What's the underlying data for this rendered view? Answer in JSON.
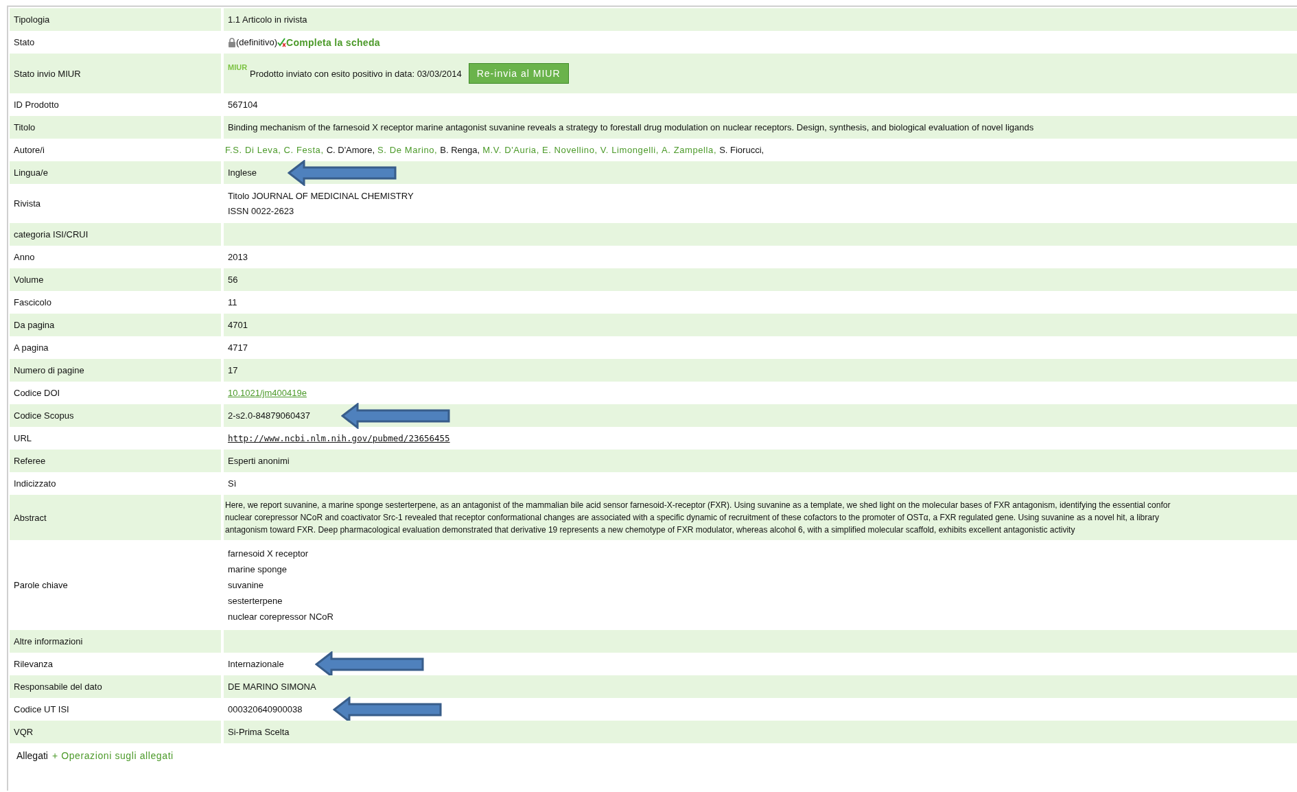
{
  "record": {
    "rows": [
      {
        "label": "Tipologia",
        "kind": "text",
        "value": "1.1 Articolo in rivista",
        "arrow": false
      },
      {
        "label": "Stato",
        "kind": "status",
        "locked": true,
        "value": "(definitivo)",
        "link": "Completa la scheda",
        "arrow": false
      },
      {
        "label": "Stato invio MIUR",
        "kind": "miur",
        "logo": "MIUR",
        "value": "Prodotto inviato con esito positivo in data: 03/03/2014",
        "button": "Re-invia al MIUR",
        "arrow": false
      },
      {
        "label": "ID Prodotto",
        "kind": "text",
        "value": "567104",
        "arrow": false
      },
      {
        "label": "Titolo",
        "kind": "text",
        "value": "Binding mechanism of the farnesoid X receptor marine antagonist suvanine reveals a strategy to forestall drug modulation on nuclear receptors. Design, synthesis, and biological evaluation of novel ligands",
        "arrow": false
      },
      {
        "label": "Autore/i",
        "kind": "authors",
        "authors": [
          {
            "name": "F.S. Di Leva,",
            "linked": true
          },
          {
            "name": "C. Festa,",
            "linked": true
          },
          {
            "name": "C. D'Amore,",
            "linked": false
          },
          {
            "name": "S. De Marino,",
            "linked": true
          },
          {
            "name": "B. Renga,",
            "linked": false
          },
          {
            "name": "M.V. D'Auria,",
            "linked": true
          },
          {
            "name": "E. Novellino,",
            "linked": true
          },
          {
            "name": "V. Limongelli,",
            "linked": true
          },
          {
            "name": "A. Zampella,",
            "linked": true
          },
          {
            "name": "S. Fiorucci,",
            "linked": false
          }
        ],
        "arrow": false
      },
      {
        "label": "Lingua/e",
        "kind": "text",
        "value": "Inglese",
        "arrow": true
      },
      {
        "label": "Rivista",
        "kind": "lines",
        "lines": [
          "Titolo JOURNAL OF MEDICINAL CHEMISTRY",
          "ISSN  0022-2623"
        ],
        "arrow": false
      },
      {
        "label": "categoria ISI/CRUI",
        "kind": "empty",
        "arrow": false
      },
      {
        "label": "Anno",
        "kind": "text",
        "value": "2013",
        "arrow": false
      },
      {
        "label": "Volume",
        "kind": "text",
        "value": "56",
        "arrow": false
      },
      {
        "label": "Fascicolo",
        "kind": "text",
        "value": "11",
        "arrow": false
      },
      {
        "label": "Da pagina",
        "kind": "text",
        "value": "4701",
        "arrow": false
      },
      {
        "label": "A pagina",
        "kind": "text",
        "value": "4717",
        "arrow": false
      },
      {
        "label": "Numero di pagine",
        "kind": "text",
        "value": "17",
        "arrow": false
      },
      {
        "label": "Codice DOI",
        "kind": "link",
        "value": "10.1021/jm400419e",
        "arrow": false
      },
      {
        "label": "Codice Scopus",
        "kind": "text",
        "value": "2-s2.0-84879060437",
        "arrow": true
      },
      {
        "label": "URL",
        "kind": "url",
        "value": "http://www.ncbi.nlm.nih.gov/pubmed/23656455",
        "arrow": false
      },
      {
        "label": "Referee",
        "kind": "text",
        "value": "Esperti anonimi",
        "arrow": false
      },
      {
        "label": "Indicizzato",
        "kind": "text",
        "value": "Sì",
        "arrow": false
      },
      {
        "label": "Abstract",
        "kind": "abstract",
        "lines": [
          "Here, we report suvanine, a marine sponge sesterterpene, as an antagonist of the mammalian bile acid sensor farnesoid-X-receptor (FXR). Using suvanine as a template, we shed light on the molecular bases of FXR antagonism, identifying the essential confor",
          "nuclear corepressor NCoR and coactivator Src-1 revealed that receptor conformational changes are associated with a specific dynamic of recruitment of these cofactors to the promoter of OSTα, a FXR regulated gene. Using suvanine as a novel hit, a library",
          "antagonism toward FXR. Deep pharmacological evaluation demonstrated that derivative 19 represents a new chemotype of FXR modulator, whereas alcohol 6, with a simplified molecular scaffold, exhibits excellent antagonistic activity"
        ],
        "arrow": false
      },
      {
        "label": "Parole chiave",
        "kind": "lines",
        "lines": [
          "farnesoid X receptor",
          "marine sponge",
          "suvanine",
          "sesterterpene",
          "nuclear corepressor NCoR"
        ],
        "arrow": false
      },
      {
        "label": "Altre informazioni",
        "kind": "empty",
        "arrow": false
      },
      {
        "label": "Rilevanza",
        "kind": "text",
        "value": "Internazionale",
        "arrow": true
      },
      {
        "label": "Responsabile del dato",
        "kind": "text",
        "value": "DE MARINO SIMONA",
        "arrow": false
      },
      {
        "label": "Codice UT ISI",
        "kind": "text",
        "value": "000320640900038",
        "arrow": true
      },
      {
        "label": "VQR",
        "kind": "text",
        "value": "Si-Prima Scelta",
        "arrow": false
      }
    ]
  },
  "attachments": {
    "label": "Allegati",
    "link": "+ Operazioni sugli allegati"
  }
}
